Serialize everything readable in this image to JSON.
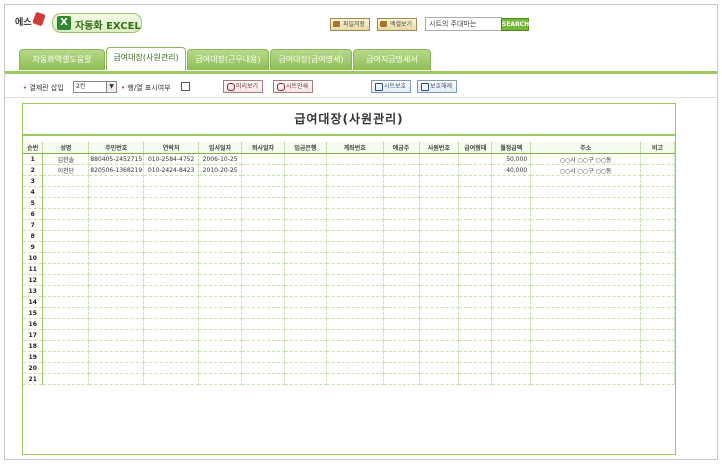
{
  "header": {
    "logo_text": "에스",
    "app_x": "X",
    "app_name": "자동화 EXCEL",
    "btn1": "파일저장",
    "btn2": "엑셀보기",
    "search_value": "시트의 주대마는",
    "search_btn": "SEARCH"
  },
  "tabs": [
    {
      "label": "자동화엑셀도움말"
    },
    {
      "label": "급여대장(사원관리)"
    },
    {
      "label": "급여대장(근무내용)"
    },
    {
      "label": "급여대장(급여명세)"
    },
    {
      "label": "급여지급명세서"
    }
  ],
  "toolbar": {
    "settle_label": "결제란 삽입",
    "settle_value": "2칸",
    "rowcol_label": "행/열 표시여부",
    "preview_btn": "미리보기",
    "print_btn": "시트인쇄",
    "save_btn": "시트보호",
    "protect_btn": "보호해제"
  },
  "sheet": {
    "title": "급여대장(사원관리)",
    "columns": [
      "순번",
      "성명",
      "주민번호",
      "연락처",
      "입사일자",
      "퇴사일자",
      "입금은행",
      "계좌번호",
      "예금주",
      "사원번호",
      "급여형태",
      "월정급액",
      "주소",
      "비고"
    ],
    "rows": [
      [
        "1",
        "김한솔",
        "880405-2452715",
        "010-2584-4752",
        "2006-10-25",
        "",
        "",
        "",
        "",
        "",
        "",
        "50,000",
        "○○시 ○○구 ○○동",
        ""
      ],
      [
        "2",
        "이천단",
        "820506-1368219",
        "010-2424-8423",
        "2010-20-25",
        "",
        "",
        "",
        "",
        "",
        "",
        "40,000",
        "○○시 ○○구 ○○동",
        ""
      ],
      [
        "3",
        "",
        "",
        "",
        "",
        "",
        "",
        "",
        "",
        "",
        "",
        "",
        "",
        ""
      ],
      [
        "4",
        "",
        "",
        "",
        "",
        "",
        "",
        "",
        "",
        "",
        "",
        "",
        "",
        ""
      ],
      [
        "5",
        "",
        "",
        "",
        "",
        "",
        "",
        "",
        "",
        "",
        "",
        "",
        "",
        ""
      ],
      [
        "6",
        "",
        "",
        "",
        "",
        "",
        "",
        "",
        "",
        "",
        "",
        "",
        "",
        ""
      ],
      [
        "7",
        "",
        "",
        "",
        "",
        "",
        "",
        "",
        "",
        "",
        "",
        "",
        "",
        ""
      ],
      [
        "8",
        "",
        "",
        "",
        "",
        "",
        "",
        "",
        "",
        "",
        "",
        "",
        "",
        ""
      ],
      [
        "9",
        "",
        "",
        "",
        "",
        "",
        "",
        "",
        "",
        "",
        "",
        "",
        "",
        ""
      ],
      [
        "10",
        "",
        "",
        "",
        "",
        "",
        "",
        "",
        "",
        "",
        "",
        "",
        "",
        ""
      ],
      [
        "11",
        "",
        "",
        "",
        "",
        "",
        "",
        "",
        "",
        "",
        "",
        "",
        "",
        ""
      ],
      [
        "12",
        "",
        "",
        "",
        "",
        "",
        "",
        "",
        "",
        "",
        "",
        "",
        "",
        ""
      ],
      [
        "13",
        "",
        "",
        "",
        "",
        "",
        "",
        "",
        "",
        "",
        "",
        "",
        "",
        ""
      ],
      [
        "14",
        "",
        "",
        "",
        "",
        "",
        "",
        "",
        "",
        "",
        "",
        "",
        "",
        ""
      ],
      [
        "15",
        "",
        "",
        "",
        "",
        "",
        "",
        "",
        "",
        "",
        "",
        "",
        "",
        ""
      ],
      [
        "16",
        "",
        "",
        "",
        "",
        "",
        "",
        "",
        "",
        "",
        "",
        "",
        "",
        ""
      ],
      [
        "17",
        "",
        "",
        "",
        "",
        "",
        "",
        "",
        "",
        "",
        "",
        "",
        "",
        ""
      ],
      [
        "18",
        "",
        "",
        "",
        "",
        "",
        "",
        "",
        "",
        "",
        "",
        "",
        "",
        ""
      ],
      [
        "19",
        "",
        "",
        "",
        "",
        "",
        "",
        "",
        "",
        "",
        "",
        "",
        "",
        ""
      ],
      [
        "20",
        "",
        "",
        "",
        "",
        "",
        "",
        "",
        "",
        "",
        "",
        "",
        "",
        ""
      ],
      [
        "21",
        "",
        "",
        "",
        "",
        "",
        "",
        "",
        "",
        "",
        "",
        "",
        "",
        ""
      ]
    ]
  }
}
